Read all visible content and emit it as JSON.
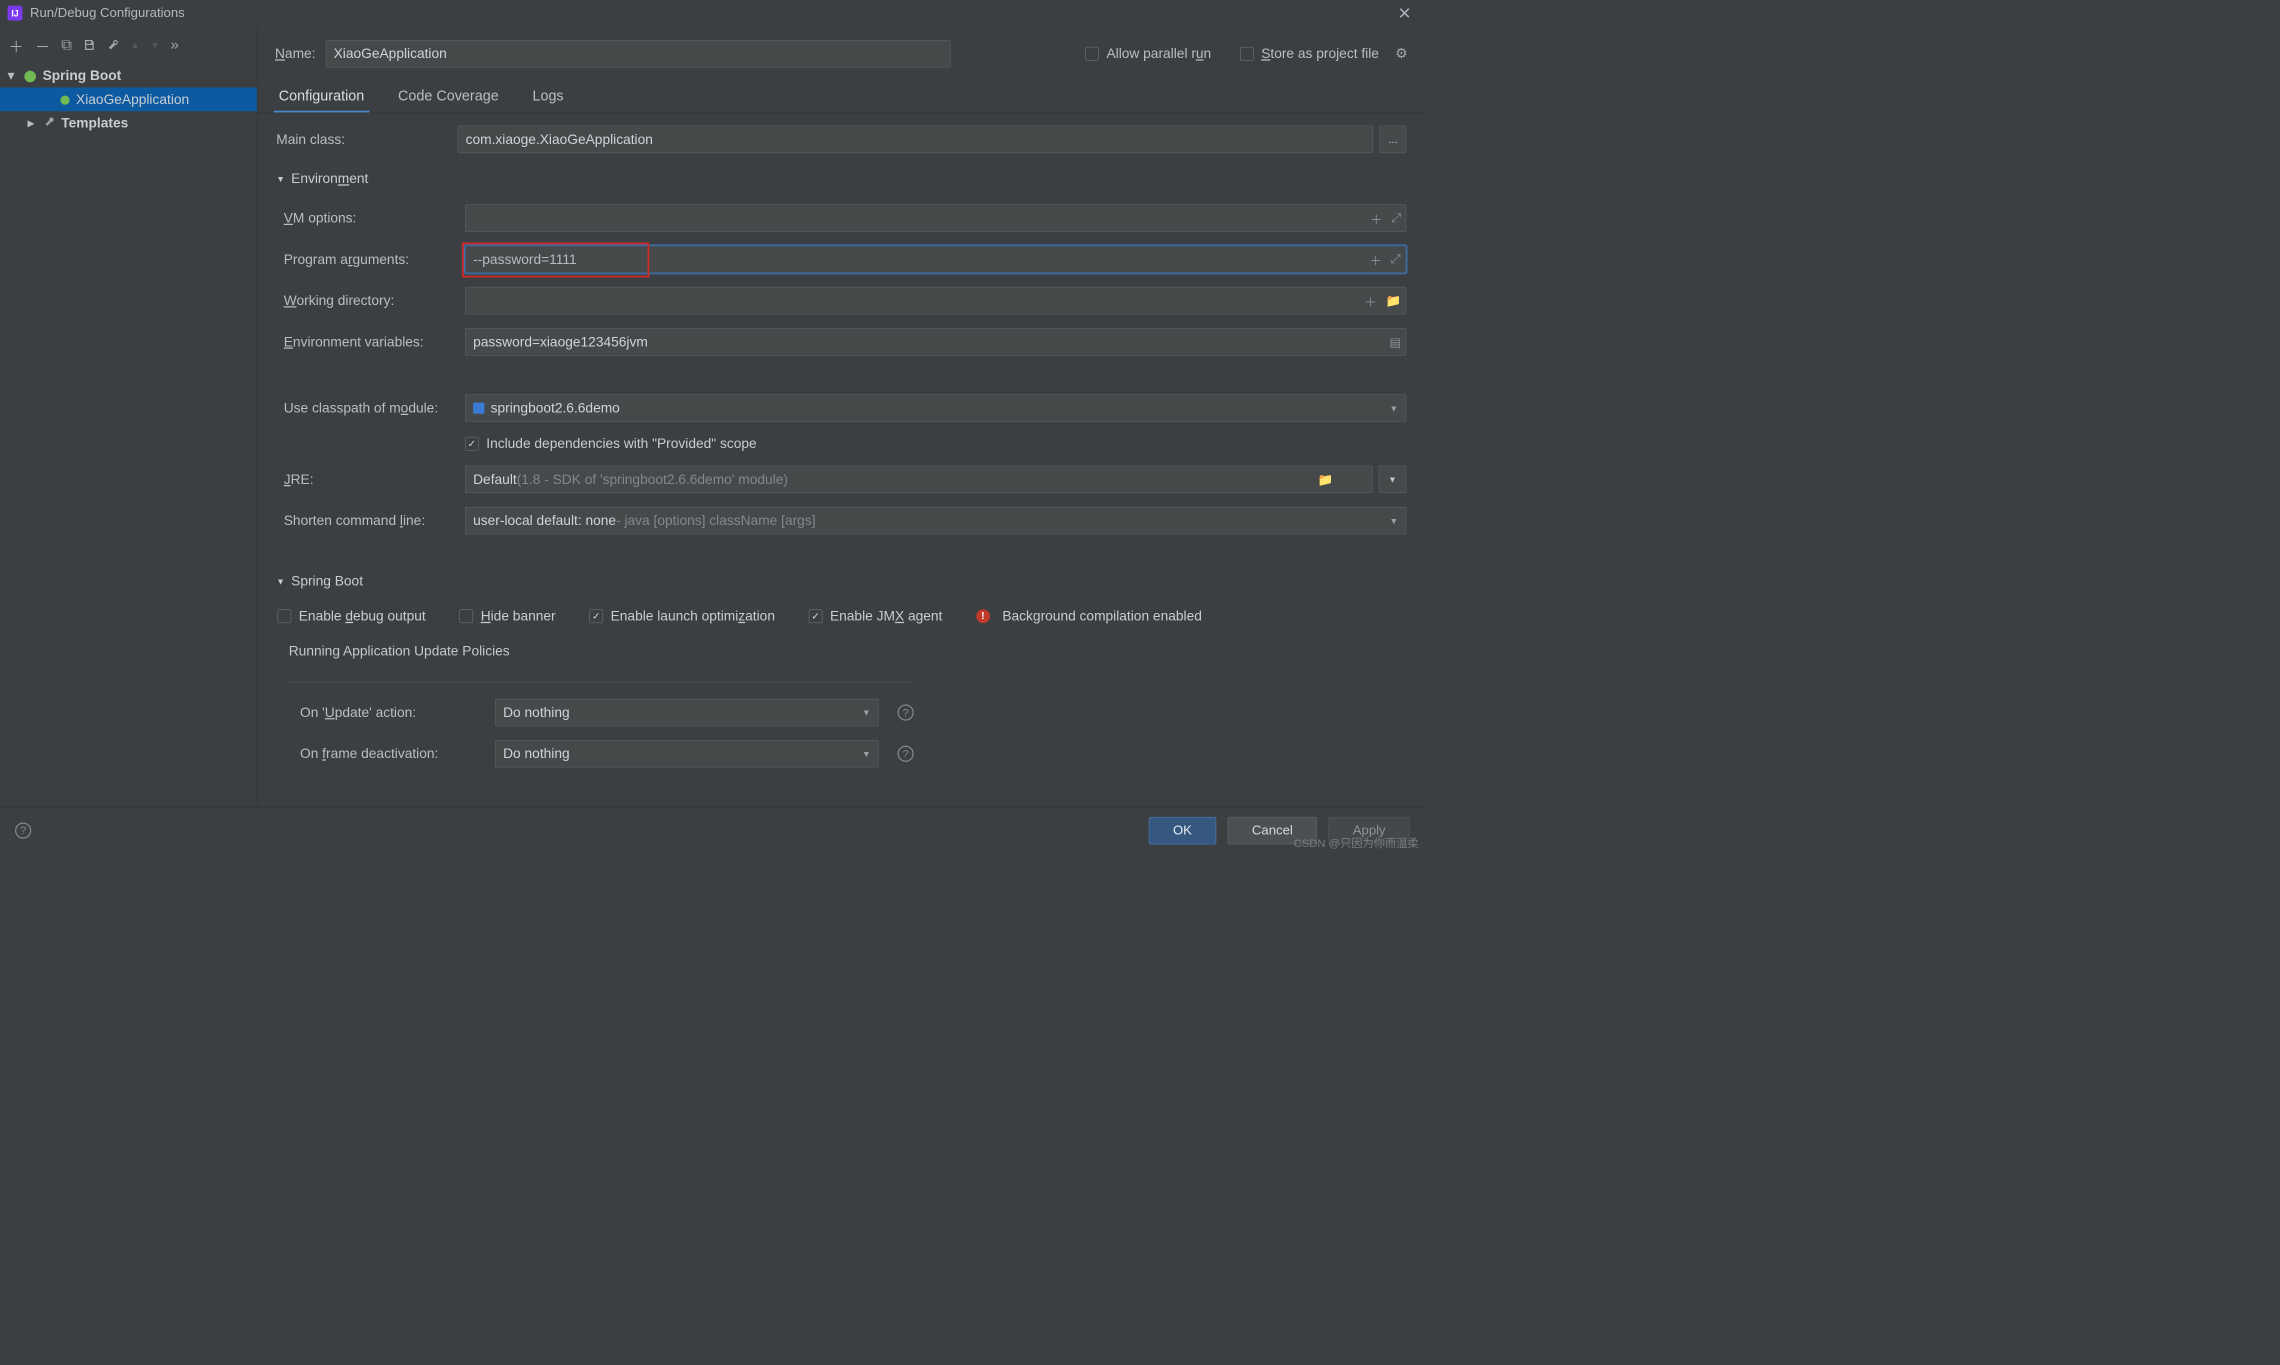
{
  "titlebar": {
    "title": "Run/Debug Configurations"
  },
  "toolbar_icons": {
    "add": "＋",
    "remove": "－",
    "copy": "⧉",
    "save": "💾",
    "wrench": "🔧",
    "up": "▲",
    "down": "▼",
    "more": "»"
  },
  "tree": {
    "spring_boot": "Spring Boot",
    "app_item": "XiaoGeApplication",
    "templates": "Templates"
  },
  "top": {
    "name_label": "Name:",
    "name_value": "XiaoGeApplication",
    "allow_parallel": "Allow parallel run",
    "store_template": "Store as project file"
  },
  "tabs": {
    "configuration": "Configuration",
    "coverage": "Code Coverage",
    "logs": "Logs"
  },
  "form": {
    "main_class_label": "Main class:",
    "main_class_value": "com.xiaoge.XiaoGeApplication",
    "browse": "...",
    "environment_section": "Environment",
    "vm_options_label": "VM options:",
    "vm_options_value": "",
    "program_args_label": "Program arguments:",
    "program_args_value": "--password=1111",
    "working_dir_label": "Working directory:",
    "working_dir_value": "",
    "env_vars_label": "Environment variables:",
    "env_vars_value": "password=xiaoge123456jvm",
    "classpath_label": "Use classpath of module:",
    "classpath_value": "springboot2.6.6demo",
    "include_provided": "Include dependencies with \"Provided\" scope",
    "jre_label": "JRE:",
    "jre_value": "Default",
    "jre_hint": " (1.8 - SDK of 'springboot2.6.6demo' module)",
    "shorten_label": "Shorten command line:",
    "shorten_value": "user-local default: none",
    "shorten_hint": " - java [options] className [args]",
    "spring_boot_section": "Spring Boot",
    "enable_debug": "Enable debug output",
    "hide_banner": "Hide banner",
    "enable_launch_opt": "Enable launch optimization",
    "enable_jmx": "Enable JMX agent",
    "bg_compile": "Background compilation enabled",
    "running_policies": "Running Application Update Policies",
    "on_update_label": "On 'Update' action:",
    "on_update_value": "Do nothing",
    "on_frame_label": "On frame deactivation:",
    "on_frame_value": "Do nothing"
  },
  "footer": {
    "ok": "OK",
    "cancel": "Cancel",
    "apply": "Apply"
  },
  "watermark": "CSDN @只因为你而温柔"
}
